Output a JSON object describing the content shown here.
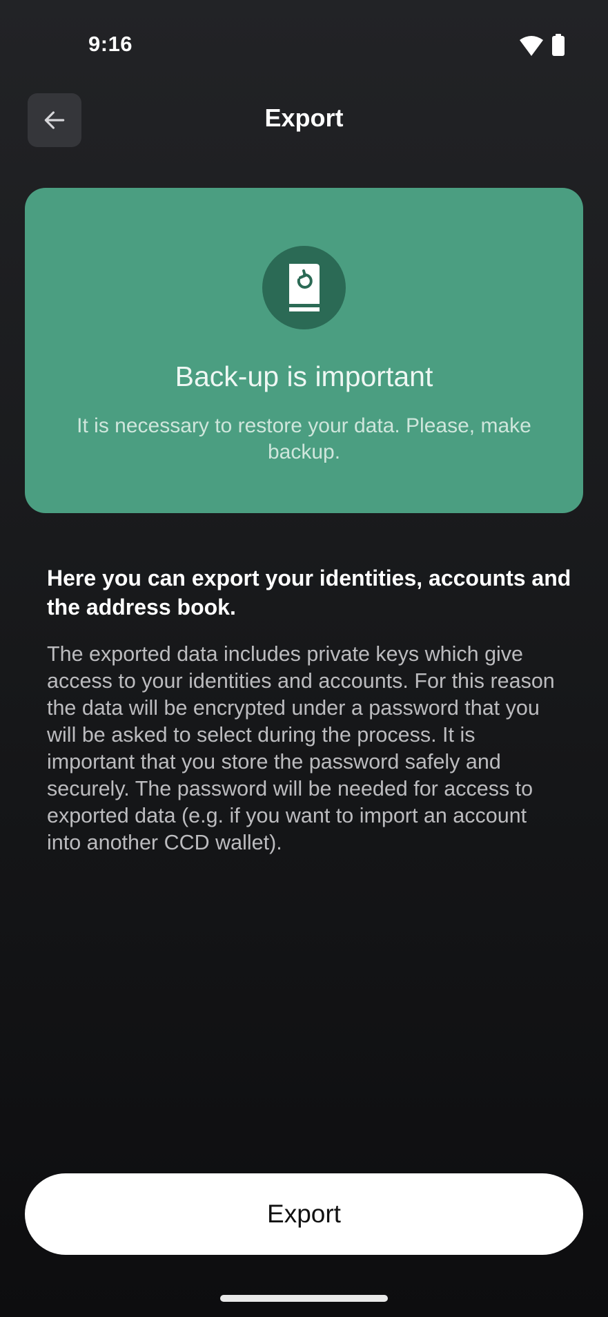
{
  "status_bar": {
    "time": "9:16",
    "icons": [
      "wifi-icon",
      "battery-icon"
    ]
  },
  "header": {
    "back_icon": "arrow-left-icon",
    "title": "Export"
  },
  "card": {
    "icon": "backup-book-icon",
    "title": "Back-up is important",
    "subtitle": "It is necessary to restore your data. Please, make backup."
  },
  "content": {
    "heading": "Here you can export your identities, accounts and the address book.",
    "body": "The exported data includes private keys which give access to your identities and accounts. For this reason the data will be encrypted under a password that you will be asked to select during the process. It is important that you store the password safely and securely. The password will be needed for access to exported data (e.g. if you want to import an account into another CCD wallet)."
  },
  "footer": {
    "export_label": "Export"
  },
  "colors": {
    "card_background": "#4b9e81",
    "card_icon_circle": "#2b6a55",
    "page_background": "#161719",
    "button_background": "#ffffff"
  }
}
